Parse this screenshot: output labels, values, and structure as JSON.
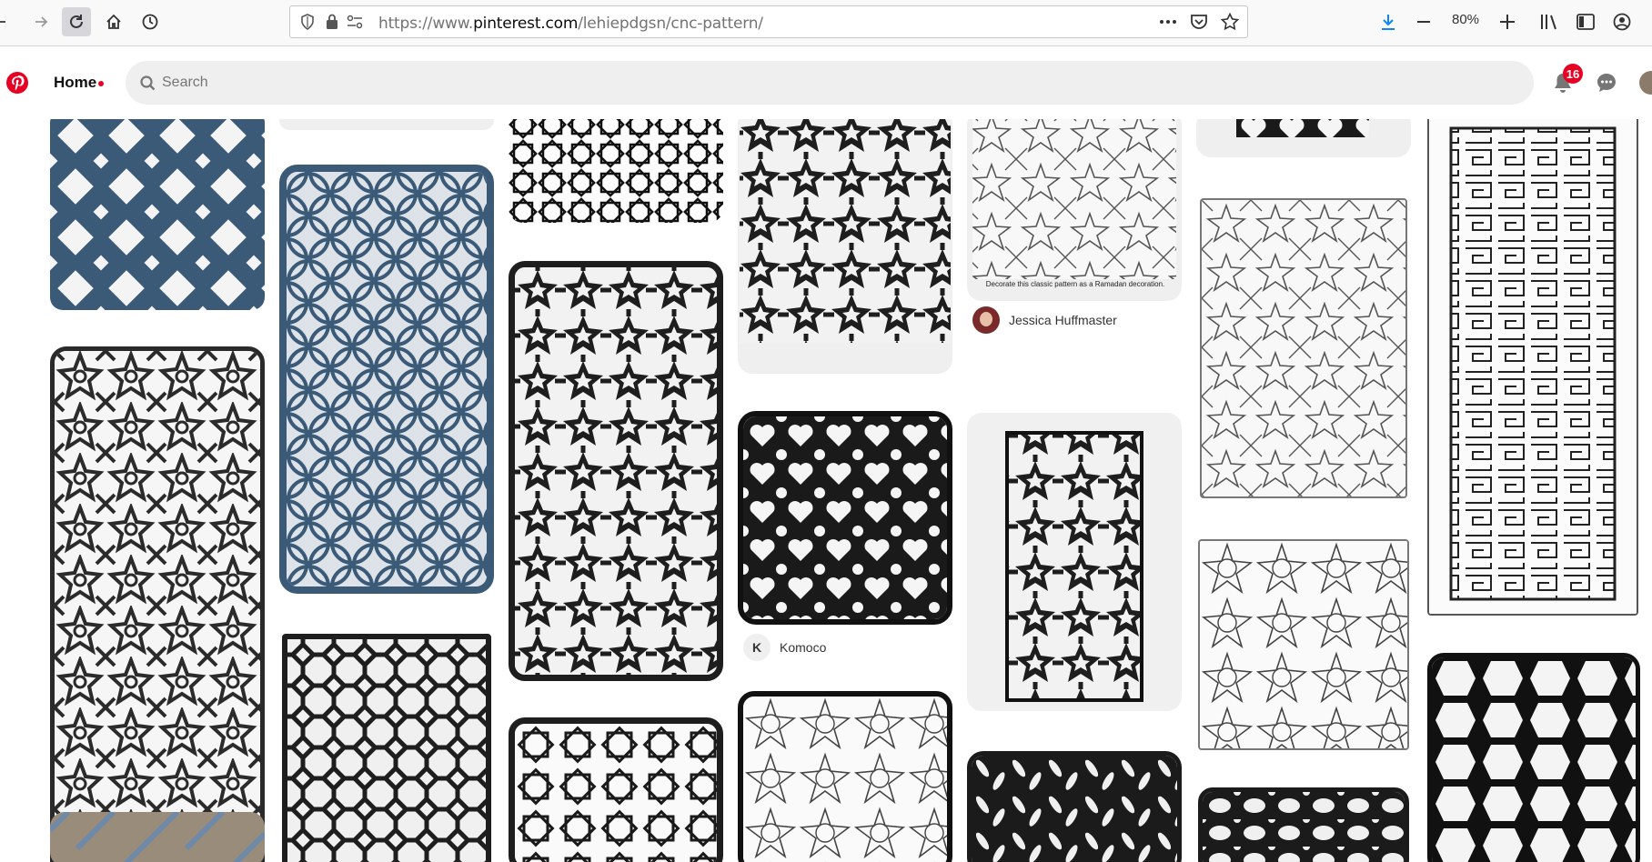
{
  "browser": {
    "url_prefix": "https://www.",
    "url_host": "pinterest.com",
    "url_path": "/lehiepdgsn/cnc-pattern/",
    "zoom": "80%"
  },
  "header": {
    "home_label": "Home",
    "search_placeholder": "Search",
    "notifications_count": "16"
  },
  "colors": {
    "brand": "#e60023",
    "teal_panel": "#3a5a78",
    "dark_panel": "#1e1e1e"
  },
  "pins": [
    {
      "id": "pin-blue-lattice",
      "caption": ""
    },
    {
      "id": "pin-blue-circles",
      "caption": ""
    },
    {
      "id": "pin-star-tiles",
      "caption": ""
    },
    {
      "id": "pin-dark-rosette",
      "caption": ""
    },
    {
      "id": "pin-ramadan-pattern",
      "caption": "Decorate this classic pattern as a Ramadan decoration."
    },
    {
      "id": "pin-star-outline",
      "caption": ""
    },
    {
      "id": "pin-maze-panel",
      "caption": ""
    }
  ],
  "attributions": {
    "jessica": "Jessica Huffmaster",
    "komoco_initial": "K",
    "komoco": "Komoco"
  }
}
